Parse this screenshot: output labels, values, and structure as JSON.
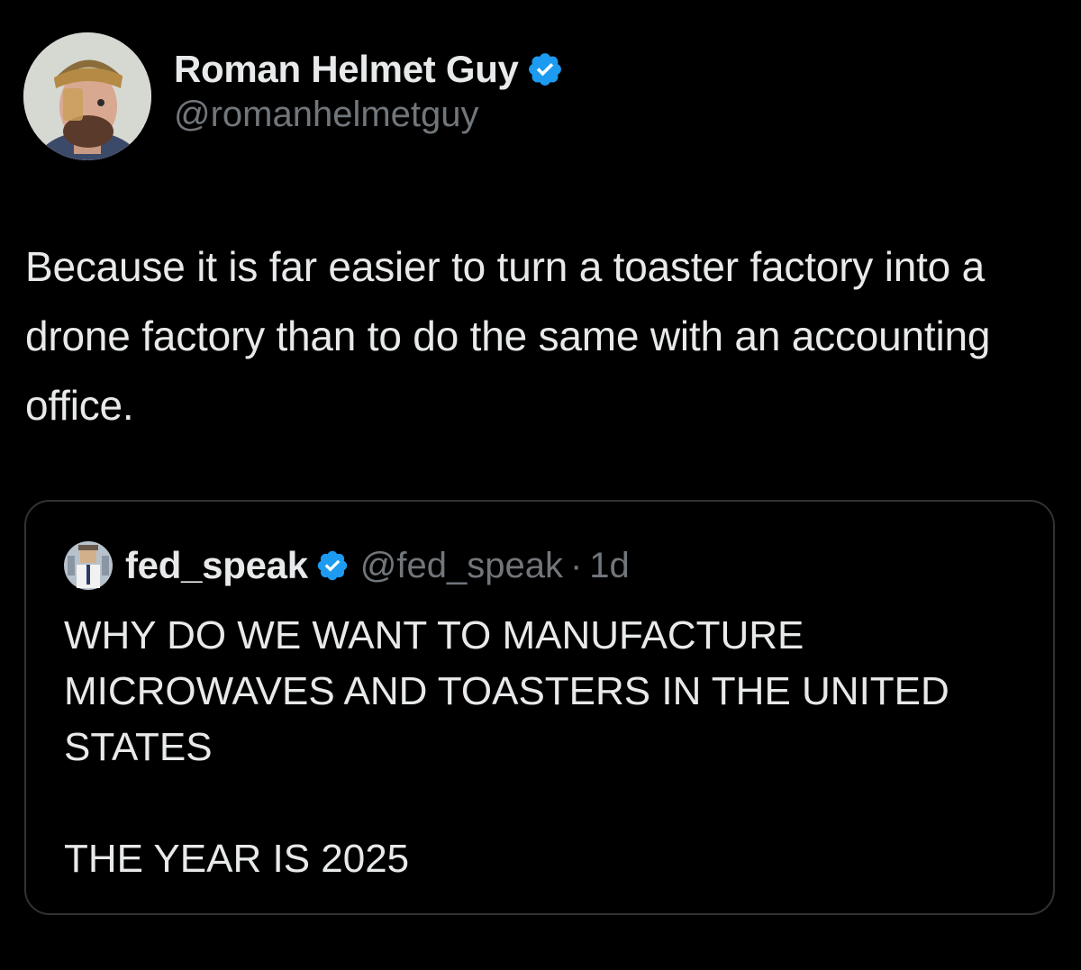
{
  "author": {
    "display_name": "Roman Helmet Guy",
    "handle": "@romanhelmetguy",
    "verified_icon": "verified-badge-icon",
    "avatar_icon": "avatar-photo"
  },
  "tweet": {
    "text": "Because it is far easier to turn a toaster factory into a drone factory than to do the same with an accounting office."
  },
  "quoted_tweet": {
    "display_name": "fed_speak",
    "handle": "@fed_speak",
    "separator": "·",
    "time": "1d",
    "verified_icon": "verified-badge-icon",
    "lines": [
      "WHY DO WE WANT TO MANUFACTURE",
      "MICROWAVES AND TOASTERS IN THE UNITED",
      "STATES"
    ],
    "closing_line": "THE YEAR IS 2025"
  },
  "colors": {
    "background": "#000000",
    "text": "#e7e9ea",
    "muted": "#71767b",
    "verified": "#1d9bf0",
    "border": "#2f3336"
  }
}
